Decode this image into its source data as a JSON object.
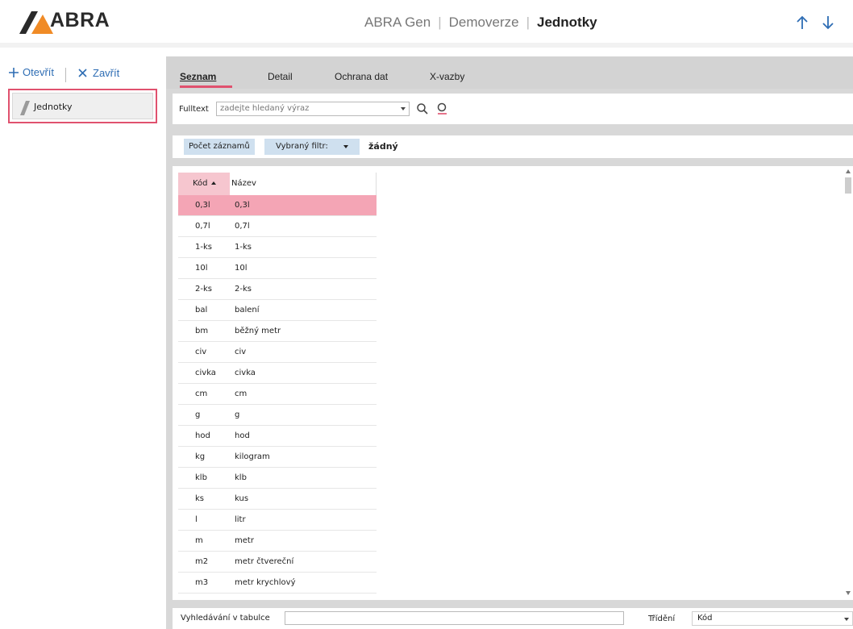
{
  "app": {
    "logo_text": "ABRA",
    "breadcrumb": [
      "ABRA Gen",
      "Demoverze"
    ],
    "current": "Jednotky"
  },
  "left": {
    "open_label": "Otevřít",
    "close_label": "Zavřít",
    "tab_label": "Jednotky"
  },
  "tabs": [
    {
      "label": "Seznam",
      "active": true
    },
    {
      "label": "Detail",
      "active": false
    },
    {
      "label": "Ochrana dat",
      "active": false
    },
    {
      "label": "X-vazby",
      "active": false
    }
  ],
  "fulltext": {
    "label": "Fulltext",
    "placeholder": "zadejte hledaný výraz"
  },
  "filter": {
    "count_label": "Počet záznamů",
    "filter_label": "Vybraný filtr:",
    "filter_value": "žádný"
  },
  "table": {
    "columns": [
      "Kód",
      "Název"
    ],
    "rows": [
      [
        "0,3l",
        "0,3l"
      ],
      [
        "0,7l",
        "0,7l"
      ],
      [
        "1-ks",
        "1-ks"
      ],
      [
        "10l",
        "10l"
      ],
      [
        "2-ks",
        "2-ks"
      ],
      [
        "bal",
        "balení"
      ],
      [
        "bm",
        "běžný metr"
      ],
      [
        "civ",
        "civ"
      ],
      [
        "civka",
        "civka"
      ],
      [
        "cm",
        "cm"
      ],
      [
        "g",
        "g"
      ],
      [
        "hod",
        "hod"
      ],
      [
        "kg",
        "kilogram"
      ],
      [
        "klb",
        "klb"
      ],
      [
        "ks",
        "kus"
      ],
      [
        "l",
        "litr"
      ],
      [
        "m",
        "metr"
      ],
      [
        "m2",
        "metr čtvereční"
      ],
      [
        "m3",
        "metr krychlový"
      ]
    ],
    "selected_index": 0
  },
  "bottom": {
    "search_label": "Vyhledávání v tabulce",
    "sort_label": "Třídění",
    "sort_value": "Kód"
  },
  "colors": {
    "accent": "#e0516e",
    "selection": "#f4a5b5",
    "link": "#2e6db4"
  }
}
